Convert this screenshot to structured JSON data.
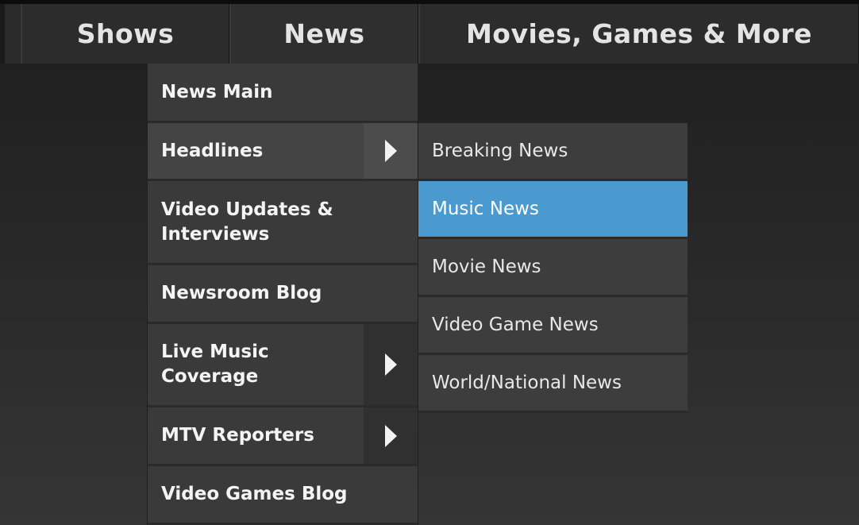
{
  "topnav": {
    "tabs": [
      {
        "label": "Shows"
      },
      {
        "label": "News"
      },
      {
        "label": "Movies, Games & More"
      }
    ]
  },
  "menu": {
    "items": [
      {
        "label": "News Main",
        "has_submenu": false
      },
      {
        "label": "Headlines",
        "has_submenu": true,
        "state": "expanded"
      },
      {
        "label": "Video Updates &\nInterviews",
        "has_submenu": false
      },
      {
        "label": "Newsroom Blog",
        "has_submenu": false
      },
      {
        "label": "Live Music\nCoverage",
        "has_submenu": true
      },
      {
        "label": "MTV Reporters",
        "has_submenu": true
      },
      {
        "label": "Video Games Blog",
        "has_submenu": false
      }
    ]
  },
  "submenu": {
    "parent": "Headlines",
    "items": [
      {
        "label": "Breaking News"
      },
      {
        "label": "Music News",
        "state": "hovered"
      },
      {
        "label": "Movie News"
      },
      {
        "label": "Video Game News"
      },
      {
        "label": "World/National News"
      }
    ]
  },
  "colors": {
    "highlight": "#4a9ad0",
    "menu_bg": "#3a3a3a",
    "nav_bg": "#2c2c2c"
  },
  "icons": {
    "submenu_indicator": "triangle-right-icon"
  }
}
